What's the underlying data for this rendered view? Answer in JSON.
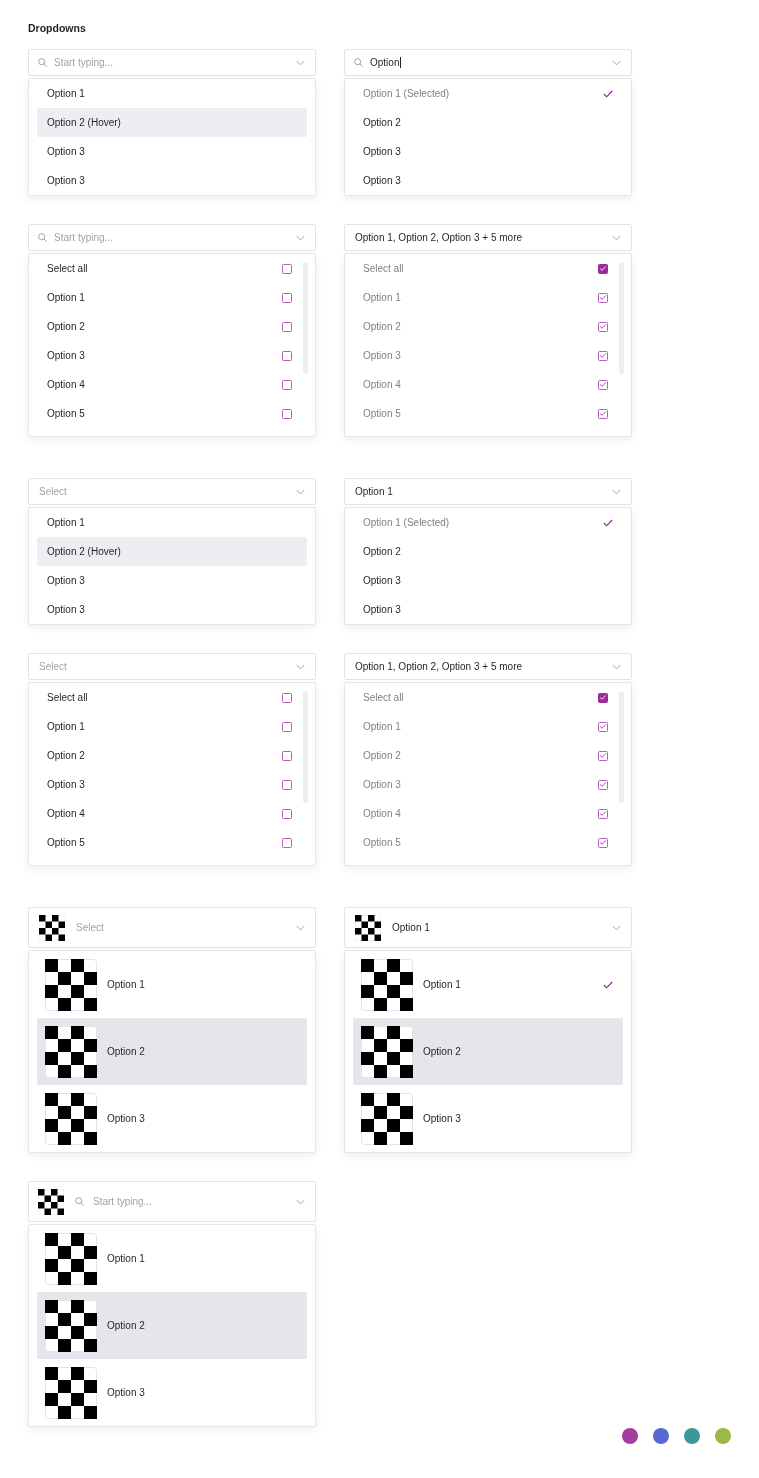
{
  "title": "Dropdowns",
  "sections": [
    {
      "dropdowns": [
        {
          "kind": "single",
          "trigger": {
            "search": true,
            "thumbnail": false,
            "focused": false,
            "placeholder": "Start typing..."
          },
          "options": [
            {
              "label": "Option 1",
              "hovered": false,
              "selected": false
            },
            {
              "label": "Option 2 (Hover)",
              "hovered": true,
              "selected": false
            },
            {
              "label": "Option 3",
              "hovered": false,
              "selected": false
            },
            {
              "label": "Option 3",
              "hovered": false,
              "selected": false
            }
          ]
        },
        {
          "kind": "single",
          "trigger": {
            "search": true,
            "thumbnail": false,
            "focused": true,
            "value": "Option"
          },
          "options": [
            {
              "label": "Option 1 (Selected)",
              "hovered": false,
              "selected": true
            },
            {
              "label": "Option 2",
              "hovered": false,
              "selected": false
            },
            {
              "label": "Option 3",
              "hovered": false,
              "selected": false
            },
            {
              "label": "Option 3",
              "hovered": false,
              "selected": false
            }
          ]
        },
        {
          "kind": "multi",
          "trigger": {
            "search": true,
            "thumbnail": false,
            "focused": false,
            "placeholder": "Start typing..."
          },
          "options": [
            {
              "kind": "all",
              "label": "Select all",
              "checked": false
            },
            {
              "kind": "item",
              "label": "Option 1",
              "checked": false
            },
            {
              "kind": "item",
              "label": "Option 2",
              "checked": false
            },
            {
              "kind": "item",
              "label": "Option 3",
              "checked": false
            },
            {
              "kind": "item",
              "label": "Option 4",
              "checked": false
            },
            {
              "kind": "item",
              "label": "Option 5",
              "checked": false
            }
          ]
        },
        {
          "kind": "multi",
          "trigger": {
            "search": false,
            "thumbnail": false,
            "focused": false,
            "value": "Option 1, Option 2, Option 3 + 5 more"
          },
          "options": [
            {
              "kind": "all",
              "label": "Select all",
              "checked": true
            },
            {
              "kind": "item",
              "label": "Option 1",
              "checked": true
            },
            {
              "kind": "item",
              "label": "Option 2",
              "checked": true
            },
            {
              "kind": "item",
              "label": "Option 3",
              "checked": true
            },
            {
              "kind": "item",
              "label": "Option 4",
              "checked": true
            },
            {
              "kind": "item",
              "label": "Option 5",
              "checked": true
            }
          ]
        }
      ]
    },
    {
      "dropdowns": [
        {
          "kind": "single",
          "trigger": {
            "search": false,
            "thumbnail": false,
            "focused": false,
            "placeholder": "Select"
          },
          "options": [
            {
              "label": "Option 1",
              "hovered": false,
              "selected": false
            },
            {
              "label": "Option 2 (Hover)",
              "hovered": true,
              "selected": false
            },
            {
              "label": "Option 3",
              "hovered": false,
              "selected": false
            },
            {
              "label": "Option 3",
              "hovered": false,
              "selected": false
            }
          ]
        },
        {
          "kind": "single",
          "trigger": {
            "search": false,
            "thumbnail": false,
            "focused": false,
            "value": "Option 1"
          },
          "options": [
            {
              "label": "Option 1 (Selected)",
              "hovered": false,
              "selected": true
            },
            {
              "label": "Option 2",
              "hovered": false,
              "selected": false
            },
            {
              "label": "Option 3",
              "hovered": false,
              "selected": false
            },
            {
              "label": "Option 3",
              "hovered": false,
              "selected": false
            }
          ]
        },
        {
          "kind": "multi",
          "trigger": {
            "search": false,
            "thumbnail": false,
            "focused": false,
            "placeholder": "Select"
          },
          "options": [
            {
              "kind": "all",
              "label": "Select all",
              "checked": false
            },
            {
              "kind": "item",
              "label": "Option 1",
              "checked": false
            },
            {
              "kind": "item",
              "label": "Option 2",
              "checked": false
            },
            {
              "kind": "item",
              "label": "Option 3",
              "checked": false
            },
            {
              "kind": "item",
              "label": "Option 4",
              "checked": false
            },
            {
              "kind": "item",
              "label": "Option 5",
              "checked": false
            }
          ]
        },
        {
          "kind": "multi",
          "trigger": {
            "search": false,
            "thumbnail": false,
            "focused": false,
            "value": "Option 1, Option 2, Option 3 + 5 more"
          },
          "options": [
            {
              "kind": "all",
              "label": "Select all",
              "checked": true
            },
            {
              "kind": "item",
              "label": "Option 1",
              "checked": true
            },
            {
              "kind": "item",
              "label": "Option 2",
              "checked": true
            },
            {
              "kind": "item",
              "label": "Option 3",
              "checked": true
            },
            {
              "kind": "item",
              "label": "Option 4",
              "checked": true
            },
            {
              "kind": "item",
              "label": "Option 5",
              "checked": true
            }
          ]
        }
      ]
    },
    {
      "dropdowns": [
        {
          "kind": "image",
          "trigger": {
            "search": false,
            "thumbnail": true,
            "focused": false,
            "placeholder": "Select"
          },
          "options": [
            {
              "label": "Option 1",
              "hovered": false,
              "selected": false
            },
            {
              "label": "Option 2",
              "hovered": true,
              "selected": false
            },
            {
              "label": "Option 3",
              "hovered": false,
              "selected": false
            }
          ]
        },
        {
          "kind": "image",
          "trigger": {
            "search": false,
            "thumbnail": true,
            "focused": false,
            "value": "Option 1"
          },
          "options": [
            {
              "label": "Option 1",
              "hovered": false,
              "selected": true
            },
            {
              "label": "Option 2",
              "hovered": true,
              "selected": false
            },
            {
              "label": "Option 3",
              "hovered": false,
              "selected": false
            }
          ]
        },
        {
          "kind": "image",
          "trigger": {
            "search": true,
            "thumbnail": true,
            "focused": false,
            "placeholder": "Start typing..."
          },
          "options": [
            {
              "label": "Option 1",
              "hovered": false,
              "selected": false
            },
            {
              "label": "Option 2",
              "hovered": true,
              "selected": false
            },
            {
              "label": "Option 3",
              "hovered": false,
              "selected": false
            }
          ]
        }
      ]
    }
  ],
  "swatches": [
    {
      "color": "#a23ea0"
    },
    {
      "color": "#5668d1"
    },
    {
      "color": "#3e9699"
    },
    {
      "color": "#9bb946"
    }
  ]
}
